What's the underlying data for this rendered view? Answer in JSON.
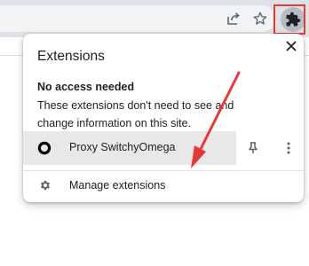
{
  "toolbar": {
    "share_icon": "share-icon",
    "bookmark_icon": "star-icon",
    "extensions_icon": "puzzle-icon"
  },
  "popup": {
    "title": "Extensions",
    "close_icon": "close-icon",
    "section_heading": "No access needed",
    "section_description": "These extensions don't need to see and change information on this site.",
    "extension": {
      "name": "Proxy SwitchyOmega",
      "icon": "ring-icon",
      "pin_icon": "pin-icon",
      "more_icon": "more-vert-icon"
    },
    "manage": {
      "label": "Manage extensions",
      "icon": "gear-icon"
    }
  },
  "annotation": {
    "highlight_color": "#e53935",
    "arrow_color": "#e53935"
  }
}
